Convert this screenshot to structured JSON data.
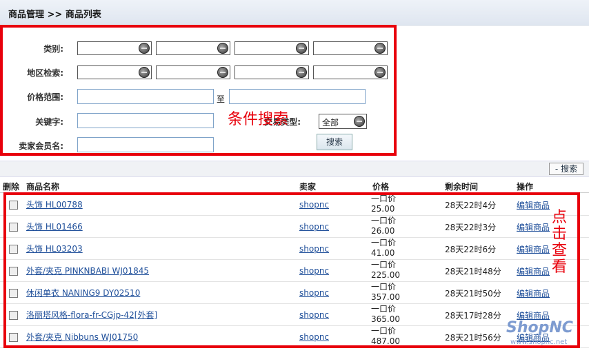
{
  "header": {
    "breadcrumb": "商品管理  >> 商品列表"
  },
  "search": {
    "category_label": "类别:",
    "region_label": "地区检索:",
    "price_label": "价格范围:",
    "price_to": "至",
    "keyword_label": "关键字:",
    "trade_label": "交易类型:",
    "trade_value": "全部",
    "seller_label": "卖家会员名:",
    "search_button": "搜索",
    "annotation": "条件搜索"
  },
  "toolbar": {
    "toggle_search": "- 搜索"
  },
  "table": {
    "headers": [
      "删除",
      "商品名称",
      "卖家",
      "价格",
      "剩余时间",
      "操作"
    ],
    "rows": [
      {
        "name": "头饰 HL00788",
        "seller": "shopnc",
        "price_type": "一口价",
        "price": "25.00",
        "time": "28天22时4分",
        "action": "编辑商品"
      },
      {
        "name": "头饰 HL01466",
        "seller": "shopnc",
        "price_type": "一口价",
        "price": "26.00",
        "time": "28天22时3分",
        "action": "编辑商品"
      },
      {
        "name": "头饰 HL03203",
        "seller": "shopnc",
        "price_type": "一口价",
        "price": "41.00",
        "time": "28天22时6分",
        "action": "编辑商品"
      },
      {
        "name": "外套/夹克 PINKNBABI WJ01845",
        "seller": "shopnc",
        "price_type": "一口价",
        "price": "225.00",
        "time": "28天21时48分",
        "action": "编辑商品"
      },
      {
        "name": "休闲单衣 NANING9 DY02510",
        "seller": "shopnc",
        "price_type": "一口价",
        "price": "357.00",
        "time": "28天21时50分",
        "action": "编辑商品"
      },
      {
        "name": "洛丽塔风格-flora-fr-CGjp-42[外套]",
        "seller": "shopnc",
        "price_type": "一口价",
        "price": "365.00",
        "time": "28天17时28分",
        "action": "编辑商品"
      },
      {
        "name": "外套/夹克 Nibbuns WJ01750",
        "seller": "shopnc",
        "price_type": "一口价",
        "price": "487.00",
        "time": "28天21时56分",
        "action": "编辑商品"
      }
    ],
    "annotation": "点击查看"
  },
  "watermark": {
    "logo": "ShopNC",
    "url": "www.shopnc.net"
  }
}
